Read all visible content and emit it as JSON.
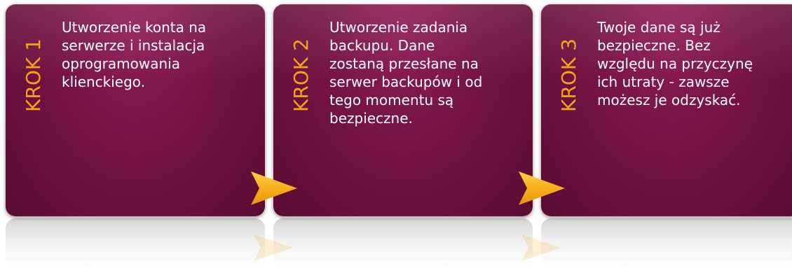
{
  "diagram": {
    "accent_color": "#f5a31a",
    "card_color": "#741343",
    "text_color": "#ffffff",
    "steps": [
      {
        "label": "KROK 1",
        "lines": [
          "Utworzenie konta na",
          "serwerze i instalacja",
          "oprogramowania",
          "klienckiego."
        ]
      },
      {
        "label": "KROK 2",
        "lines": [
          "Utworzenie zadania",
          "backupu. Dane",
          "zostaną przesłane na",
          "serwer backupów i od",
          "tego momentu są",
          "bezpieczne."
        ]
      },
      {
        "label": "KROK 3",
        "lines": [
          "Twoje dane są już",
          "bezpieczne. Bez",
          "względu na przyczynę",
          "ich utraty - zawsze",
          "możesz je odzyskać."
        ]
      }
    ]
  }
}
